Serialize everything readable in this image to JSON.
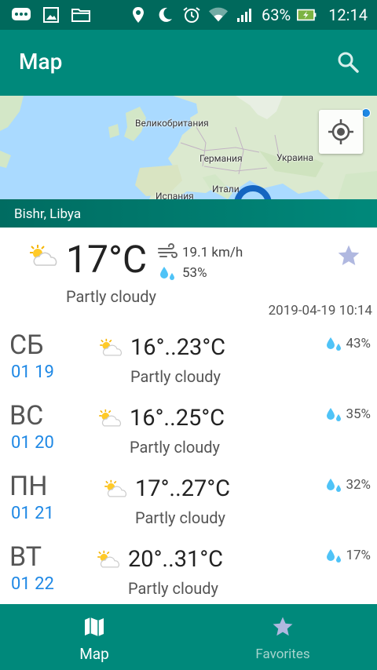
{
  "status_bar": {
    "battery_percent": "63%",
    "time": "12:14",
    "icons": [
      "messages-icon",
      "gallery-icon",
      "folder-icon",
      "location-icon",
      "do-not-disturb-icon",
      "alarm-icon",
      "wifi-icon",
      "signal-icon",
      "battery-charging-icon"
    ]
  },
  "app_bar": {
    "title": "Map",
    "search_icon": "search-icon"
  },
  "map": {
    "labels": {
      "uk": "Великобритания",
      "germany": "Германия",
      "ukraine": "Украина",
      "spain": "Испания",
      "italy": "Итали"
    },
    "locate_icon": "my-location-icon"
  },
  "location": {
    "name": "Bishr, Libya"
  },
  "current": {
    "temperature": "17°C",
    "wind": "19.1 km/h",
    "humidity": "53%",
    "description": "Partly cloudy",
    "updated": "2019-04-19 10:14",
    "icon": "partly-cloudy-icon",
    "favorite_icon": "star-icon"
  },
  "forecast": [
    {
      "day": "СБ",
      "date": "01 19",
      "temp": "16°..23°C",
      "desc": "Partly cloudy",
      "precip": "43%"
    },
    {
      "day": "ВС",
      "date": "01 20",
      "temp": "16°..25°C",
      "desc": "Partly cloudy",
      "precip": "35%"
    },
    {
      "day": "ПН",
      "date": "01 21",
      "temp": "17°..27°C",
      "desc": "Partly cloudy",
      "precip": "32%"
    },
    {
      "day": "ВТ",
      "date": "01 22",
      "temp": "20°..31°C",
      "desc": "Partly cloudy",
      "precip": "17%"
    }
  ],
  "bottom_nav": {
    "map_label": "Map",
    "favorites_label": "Favorites"
  },
  "colors": {
    "status_bar": "#00695c",
    "primary": "#00897b",
    "accent_blue": "#1e88e5",
    "star_inactive": "#b0b8e0"
  }
}
